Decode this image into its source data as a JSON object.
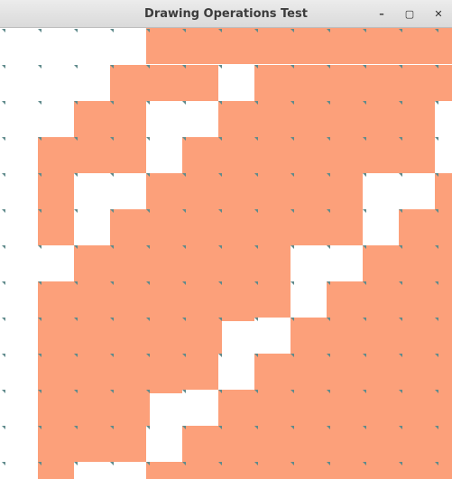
{
  "window": {
    "title": "Drawing Operations Test",
    "buttons": {
      "minimize": "–",
      "maximize": "▢",
      "close": "✕"
    }
  },
  "canvas": {
    "fill_color": "#fca07a",
    "highlight_color": "#ffffff",
    "marker_color": "#5f8a8b",
    "rows": [
      "WWWOOOOOOOOOO",
      "WWWOOOOOOOOOO",
      "WWWOOOOOOOOOO",
      "WWWOOOOOOOOOO",
      "WWWOOOOOOOOOO",
      "WWWOOOOOOOOOO",
      "WWWOOOOOOOOOO",
      "WWWOOOOOOOOOO",
      "WWWOOOOOOOOOO",
      "WWWOOOOOOOOOO",
      "WWWOOOOOOOOOO",
      "WWWOOOOOOOOOO",
      "WWWOOOOOOOOOO"
    ],
    "cells": [
      "0000LLLLLLLLL",
      "0000LLLLLLLLL",
      "000LLLLLLLLLL",
      "00LLLLLLLLLLL",
      "0LLLLLLLLLLLL",
      "0LLLLLLLLLLLL",
      "0LLLLLLLLLLLL",
      "0LLLLLLLLLLLL",
      "0LLLLLLLLLLLL",
      "0LLLLLLLLLLLL",
      "0LLLLLLLLLLLL",
      "0LLLLLLLLLLLL",
      "0LLLLLLLLLLLL"
    ]
  }
}
